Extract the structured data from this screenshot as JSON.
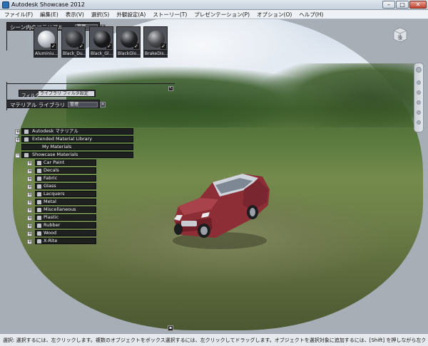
{
  "window": {
    "title": "Autodesk Showcase 2012",
    "min": "–",
    "max": "□",
    "close": "✕"
  },
  "menu": [
    "ファイル(F)",
    "編集(E)",
    "表示(V)",
    "選択(S)",
    "外観設定(A)",
    "ストーリー(T)",
    "プレゼンテーション(P)",
    "オプション(O)",
    "ヘルプ(H)"
  ],
  "scene_panel": {
    "title": "シーン内のマテリアル",
    "dropdown": "管理",
    "close": "✕",
    "thumbnails": [
      {
        "label": "Aluminiu...",
        "color": "#c9cdd3"
      },
      {
        "label": "Black_Du...",
        "color": "#2b2c2f"
      },
      {
        "label": "Black_Gl...",
        "color": "#1a1b1d"
      },
      {
        "label": "BlackGlo...",
        "color": "#222326"
      },
      {
        "label": "BrakeDis...",
        "color": "#4a4b4e"
      }
    ],
    "check": "✓"
  },
  "library_panel": {
    "title": "マテリアル ライブラリ",
    "dropdown": "管理",
    "close": "✕",
    "filter_label": "フィルタ",
    "filter_value": "ライブラリ フィルタ設定",
    "top_items": [
      {
        "label": "Autodesk マテリアル",
        "expander": "+"
      },
      {
        "label": "Extended Material Library",
        "expander": "+"
      },
      {
        "label": "My Materials",
        "expander": ""
      },
      {
        "label": "Showcase Materials",
        "expander": "−"
      }
    ],
    "sub_items": [
      "Car Paint",
      "Decals",
      "Fabric",
      "Glass",
      "Lacquers",
      "Metal",
      "Miscellaneous",
      "Plastic",
      "Rubber",
      "Wood",
      "X-Rite"
    ]
  },
  "viewcube": {
    "face": "後"
  },
  "markers": {
    "top": "↖",
    "bottom": "▪"
  },
  "status": "選択: 選択するには、左クリックします。複数のオブジェクトをボックス選択するには、左クリックしてドラッグします。オブジェクトを選択対象に追加するには、[Shift] を押しながら左クリックします。オ"
}
